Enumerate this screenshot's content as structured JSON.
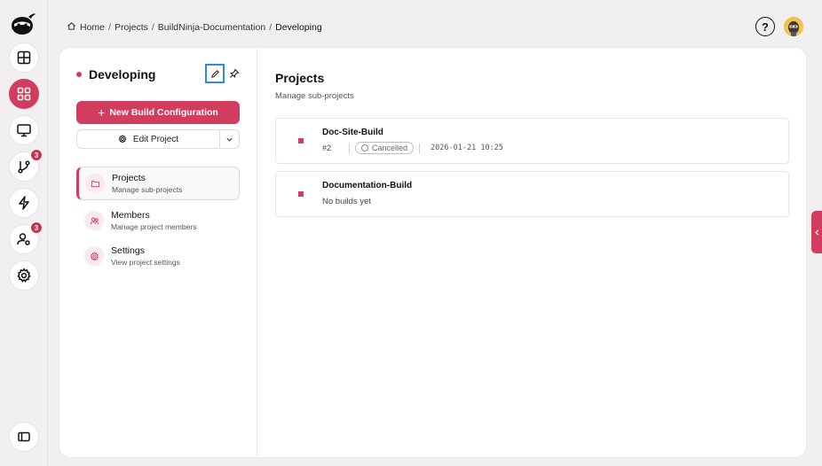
{
  "breadcrumb": {
    "items": [
      "Home",
      "Projects",
      "BuildNinja-Documentation",
      "Developing"
    ],
    "separator": "/"
  },
  "header": {
    "help_label": "?"
  },
  "rail": {
    "badges": {
      "vcs": "3",
      "users": "3"
    },
    "accent_color": "#d23d5f"
  },
  "project": {
    "name": "Developing",
    "new_build_label": "New Build Configuration",
    "edit_project_label": "Edit Project"
  },
  "nav": [
    {
      "title": "Projects",
      "subtitle": "Manage sub-projects"
    },
    {
      "title": "Members",
      "subtitle": "Manage project members"
    },
    {
      "title": "Settings",
      "subtitle": "View project settings"
    }
  ],
  "main": {
    "title": "Projects",
    "subtitle": "Manage sub-projects",
    "subprojects": [
      {
        "name": "Doc-Site-Build",
        "build_number": "#2",
        "status": "Cancelled",
        "timestamp": "2026-01-21 10:25"
      },
      {
        "name": "Documentation-Build",
        "empty_text": "No builds yet"
      }
    ]
  }
}
